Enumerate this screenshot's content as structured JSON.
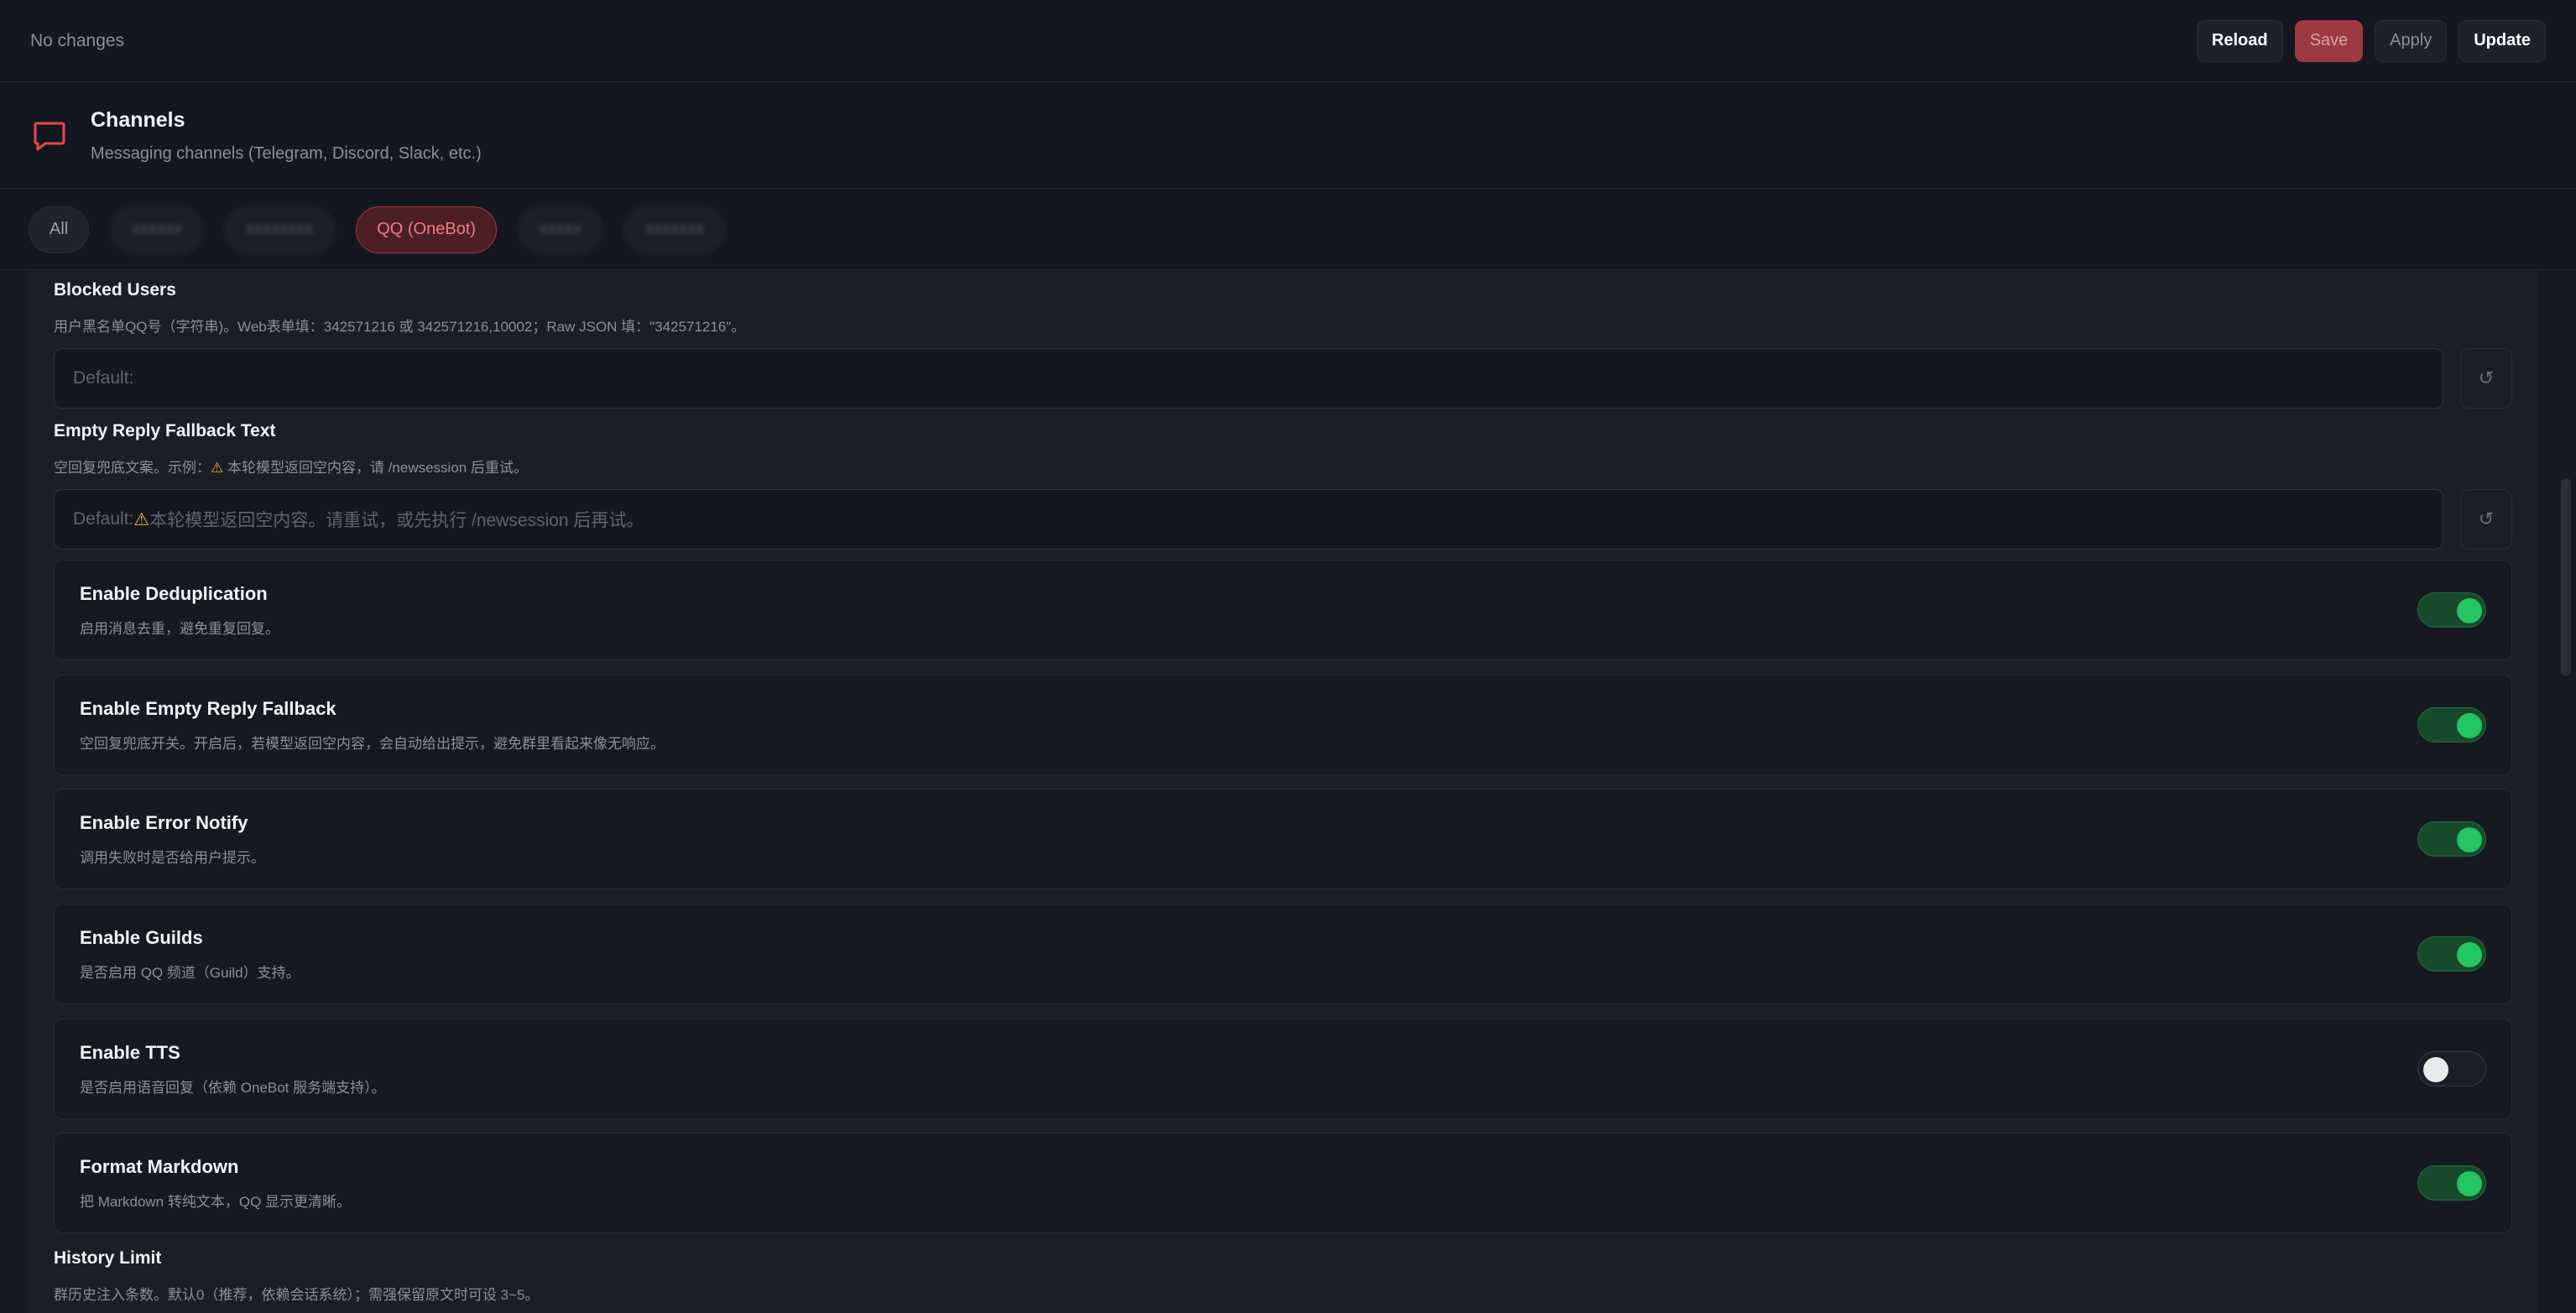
{
  "topbar": {
    "status": "No changes",
    "buttons": {
      "reload": "Reload",
      "save": "Save",
      "apply": "Apply",
      "update": "Update"
    }
  },
  "section": {
    "icon": "message-icon",
    "title": "Channels",
    "subtitle": "Messaging channels (Telegram, Discord, Slack, etc.)"
  },
  "tabs": [
    {
      "label": "All",
      "state": "normal"
    },
    {
      "label": "",
      "state": "blurred"
    },
    {
      "label": "",
      "state": "blurred"
    },
    {
      "label": "QQ (OneBot)",
      "state": "active"
    },
    {
      "label": "",
      "state": "blurred"
    },
    {
      "label": "",
      "state": "blurred"
    }
  ],
  "fields": {
    "blocked_users": {
      "label": "Blocked Users",
      "desc": "用户黑名单QQ号（字符串)。Web表单填：342571216 或 342571216,10002；Raw JSON 填：\"342571216\"。",
      "placeholder": "Default:",
      "reset": "↺"
    },
    "empty_reply_text": {
      "label": "Empty Reply Fallback Text",
      "desc_prefix": "空回复兜底文案。示例：",
      "desc_warn": "⚠",
      "desc_suffix": " 本轮模型返回空内容，请 /newsession 后重试。",
      "placeholder_prefix": "Default: ",
      "placeholder_warn": "⚠",
      "placeholder_suffix": " 本轮模型返回空内容。请重试，或先执行 /newsession 后再试。",
      "reset": "↺"
    },
    "history_limit": {
      "label": "History Limit",
      "desc": "群历史注入条数。默认0（推荐，依赖会话系统）；需强保留原文时可设 3~5。"
    }
  },
  "toggles": [
    {
      "label": "Enable Deduplication",
      "desc": "启用消息去重，避免重复回复。",
      "on": true
    },
    {
      "label": "Enable Empty Reply Fallback",
      "desc": "空回复兜底开关。开启后，若模型返回空内容，会自动给出提示，避免群里看起来像无响应。",
      "on": true
    },
    {
      "label": "Enable Error Notify",
      "desc": "调用失败时是否给用户提示。",
      "on": true
    },
    {
      "label": "Enable Guilds",
      "desc": "是否启用 QQ 频道（Guild）支持。",
      "on": true
    },
    {
      "label": "Enable TTS",
      "desc": "是否启用语音回复（依赖 OneBot 服务端支持）。",
      "on": false
    },
    {
      "label": "Format Markdown",
      "desc": "把 Markdown 转纯文本，QQ 显示更清晰。",
      "on": true
    }
  ],
  "colors": {
    "accent": "#f07b83",
    "toggle_on": "#22c55e",
    "background": "#161920"
  }
}
